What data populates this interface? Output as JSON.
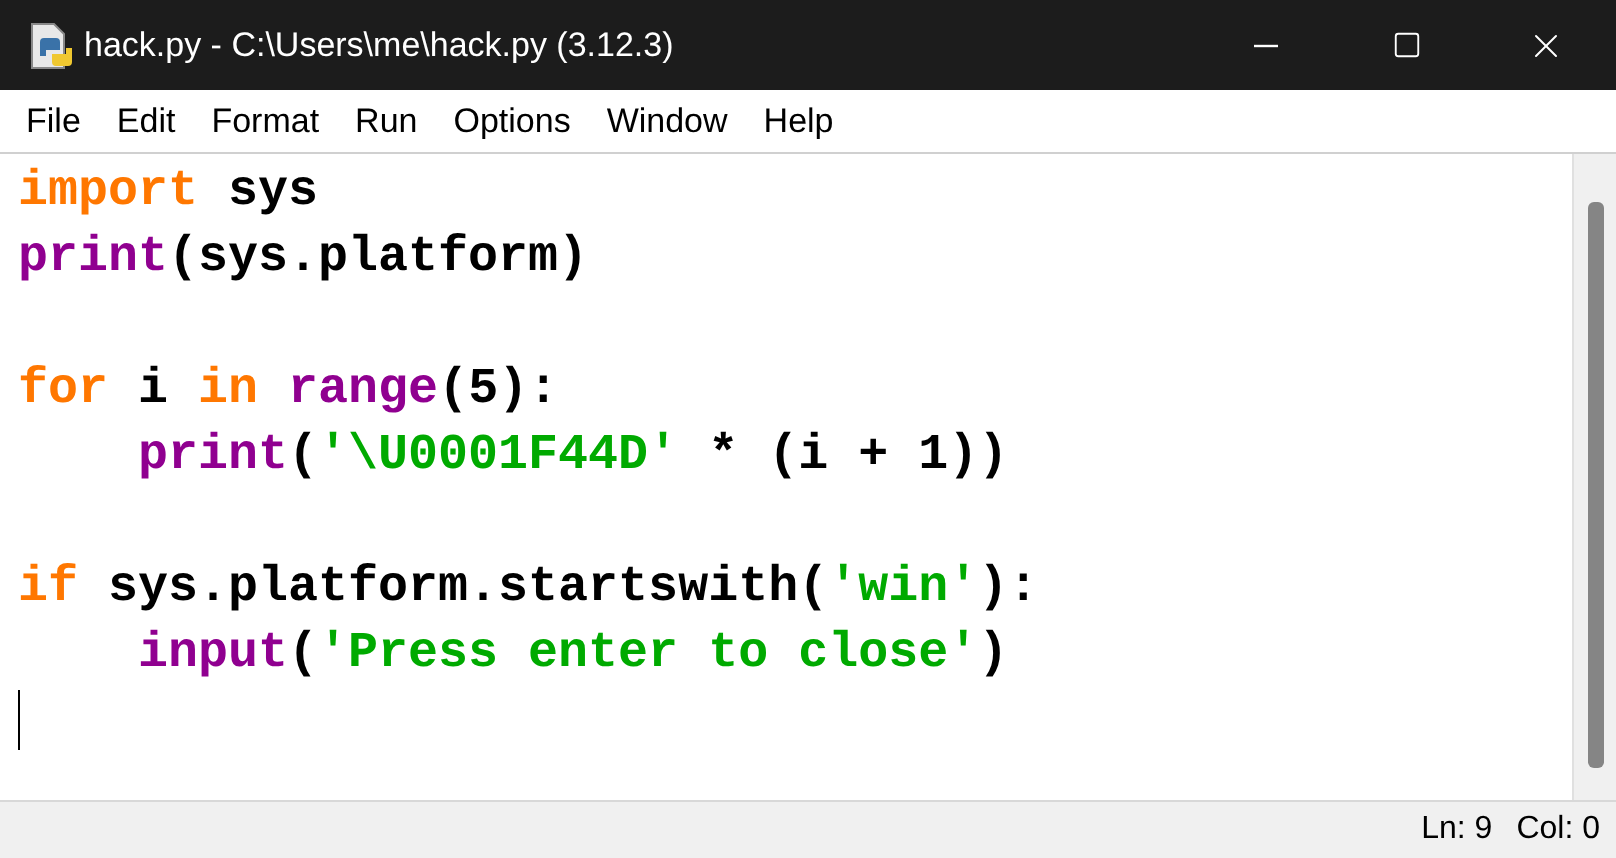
{
  "window": {
    "title": "hack.py - C:\\Users\\me\\hack.py (3.12.3)"
  },
  "menu": [
    "File",
    "Edit",
    "Format",
    "Run",
    "Options",
    "Window",
    "Help"
  ],
  "editor": {
    "lines": [
      {
        "kind": "code",
        "tokens": [
          {
            "kind": "keyword",
            "text": "import"
          },
          {
            "kind": "plain",
            "text": " sys"
          }
        ]
      },
      {
        "kind": "code",
        "tokens": [
          {
            "kind": "builtin",
            "text": "print"
          },
          {
            "kind": "plain",
            "text": "(sys.platform)"
          }
        ]
      },
      {
        "kind": "blank"
      },
      {
        "kind": "code",
        "tokens": [
          {
            "kind": "keyword",
            "text": "for"
          },
          {
            "kind": "plain",
            "text": " i "
          },
          {
            "kind": "keyword",
            "text": "in"
          },
          {
            "kind": "builtin",
            "text": "range",
            "space_before": true
          },
          {
            "kind": "plain",
            "text": "(5):"
          }
        ]
      },
      {
        "kind": "code",
        "indent": true,
        "tokens": [
          {
            "kind": "builtin",
            "text": "print"
          },
          {
            "kind": "plain",
            "text": "("
          },
          {
            "kind": "string",
            "text": "'\\U0001F44D'"
          },
          {
            "kind": "plain",
            "text": " * (i + 1))"
          }
        ]
      },
      {
        "kind": "blank"
      },
      {
        "kind": "code",
        "tokens": [
          {
            "kind": "keyword",
            "text": "if"
          },
          {
            "kind": "plain",
            "text": " sys.platform.startswith("
          },
          {
            "kind": "string",
            "text": "'win'"
          },
          {
            "kind": "plain",
            "text": "):"
          }
        ]
      },
      {
        "kind": "code",
        "indent": true,
        "tokens": [
          {
            "kind": "builtin",
            "text": "input"
          },
          {
            "kind": "plain",
            "text": "("
          },
          {
            "kind": "string",
            "text": "'Press enter to close'"
          },
          {
            "kind": "plain",
            "text": ")"
          }
        ]
      },
      {
        "kind": "blank",
        "cursor": true
      }
    ]
  },
  "status_bar": {
    "line": "Ln: 9",
    "column": "Col: 0"
  }
}
